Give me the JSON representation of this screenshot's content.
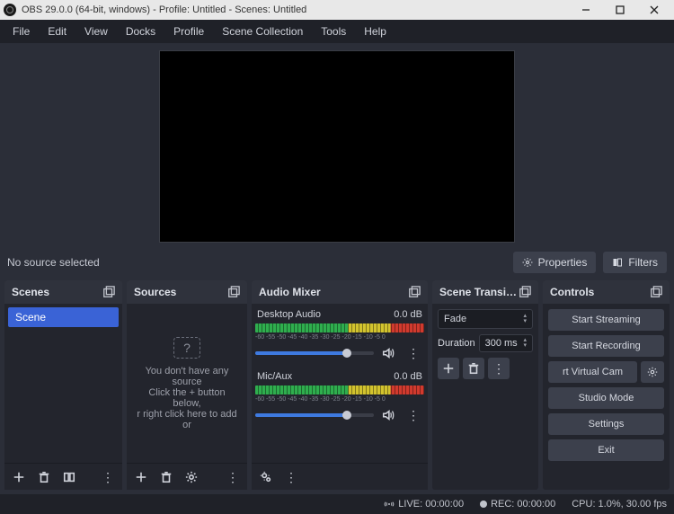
{
  "title": "OBS 29.0.0 (64-bit, windows) - Profile: Untitled - Scenes: Untitled",
  "menu": {
    "file": "File",
    "edit": "Edit",
    "view": "View",
    "docks": "Docks",
    "profile": "Profile",
    "scenecol": "Scene Collection",
    "tools": "Tools",
    "help": "Help"
  },
  "midrow": {
    "nosource": "No source selected",
    "properties": "Properties",
    "filters": "Filters"
  },
  "scenes": {
    "header": "Scenes",
    "item": "Scene"
  },
  "sources": {
    "header": "Sources",
    "empty1": "You don't have any source",
    "empty2": "Click the + button below,",
    "empty3": "r right click here to add or"
  },
  "mixer": {
    "header": "Audio Mixer",
    "ch1": {
      "name": "Desktop Audio",
      "level": "0.0 dB",
      "ticks": "-60 -55 -50 -45 -40 -35 -30 -25 -20 -15 -10 -5 0"
    },
    "ch2": {
      "name": "Mic/Aux",
      "level": "0.0 dB",
      "ticks": "-60 -55 -50 -45 -40 -35 -30 -25 -20 -15 -10 -5 0"
    }
  },
  "trans": {
    "header": "Scene Transiti…",
    "select": "Fade",
    "duration_label": "Duration",
    "duration_value": "300 ms"
  },
  "controls": {
    "header": "Controls",
    "start_stream": "Start Streaming",
    "start_rec": "Start Recording",
    "vcam": "rt Virtual Cam",
    "studio": "Studio Mode",
    "settings": "Settings",
    "exit": "Exit"
  },
  "status": {
    "live": "LIVE: 00:00:00",
    "rec": "REC: 00:00:00",
    "cpu": "CPU: 1.0%, 30.00 fps"
  }
}
